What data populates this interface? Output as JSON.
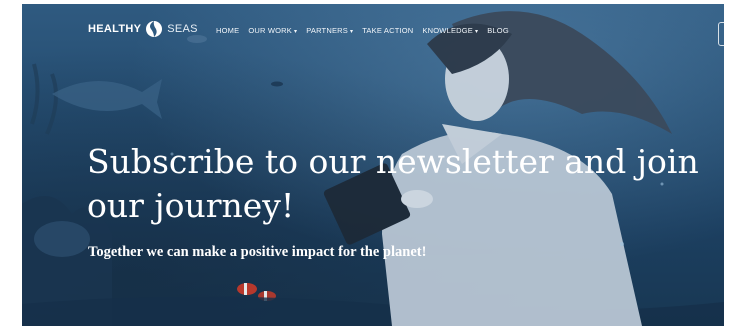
{
  "brand": {
    "part1": "HEALTHY",
    "part2": "SEAS"
  },
  "nav": {
    "items": [
      {
        "label": "HOME",
        "dropdown": false
      },
      {
        "label": "OUR WORK",
        "dropdown": true
      },
      {
        "label": "PARTNERS",
        "dropdown": true
      },
      {
        "label": "TAKE ACTION",
        "dropdown": false
      },
      {
        "label": "KNOWLEDGE",
        "dropdown": true
      },
      {
        "label": "BLOG",
        "dropdown": false
      }
    ]
  },
  "hero": {
    "headline": "Subscribe to our newsletter and join our journey!",
    "subheadline": "Together we can make a positive impact for the planet!"
  },
  "colors": {
    "ocean": "#244c70",
    "text": "#ffffff"
  }
}
